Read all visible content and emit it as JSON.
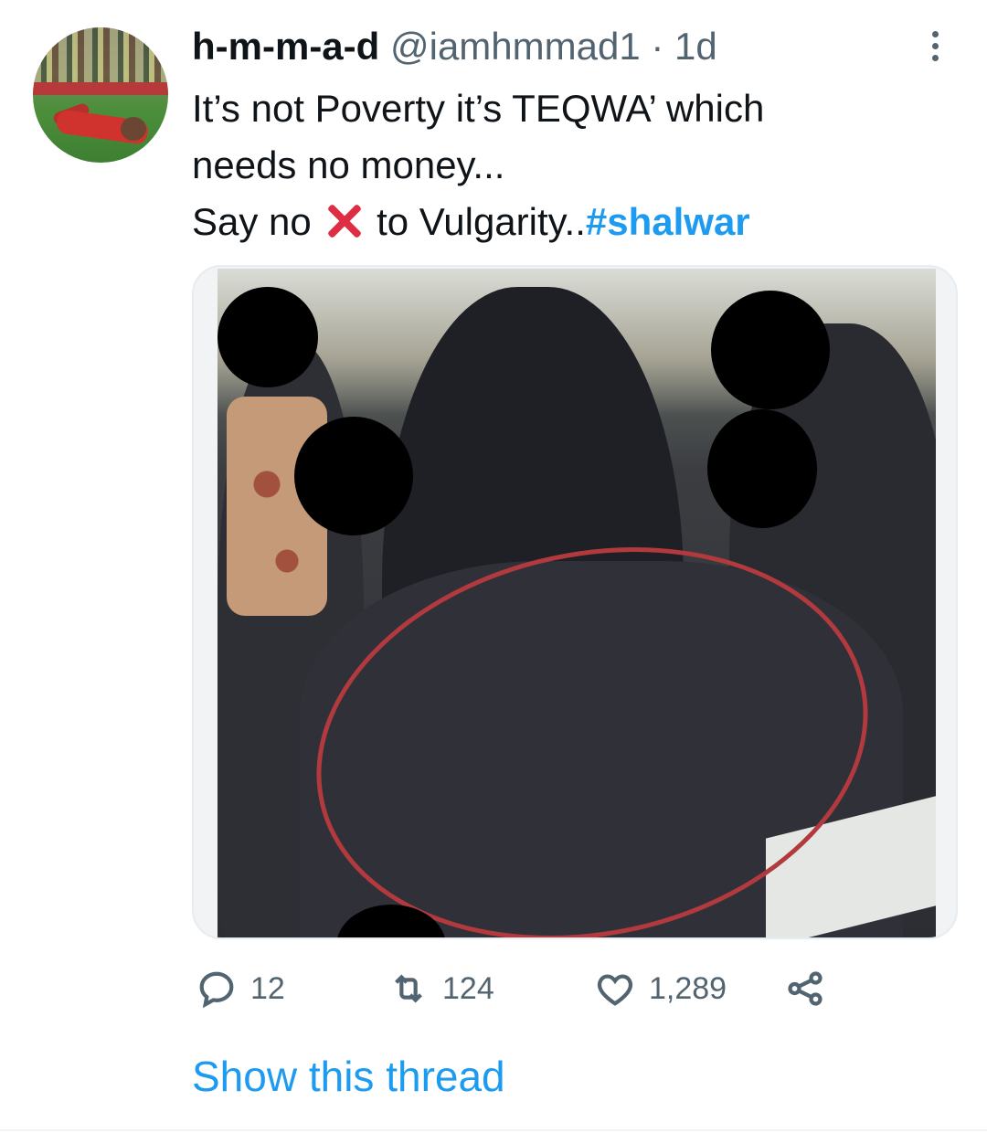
{
  "tweet": {
    "author_name": "h-m-m-a-d",
    "author_handle": "@iamhmmad1",
    "separator": "·",
    "time": "1d",
    "text_line1": "It’s not Poverty it’s TEQWA’ which",
    "text_line2": "needs no money...",
    "text_line3_before": "Say no ",
    "text_line3_after": " to Vulgarity..",
    "hashtag": "#shalwar"
  },
  "icons": {
    "more": "more-horizontal-icon",
    "emoji": "cross-mark-emoji",
    "reply": "reply-icon",
    "retweet": "retweet-icon",
    "like": "like-icon",
    "share": "share-icon"
  },
  "actions": {
    "reply_count": "12",
    "retweet_count": "124",
    "like_count": "1,289"
  },
  "show_thread_label": "Show this thread",
  "colors": {
    "link": "#1d9bf0",
    "text": "#0f1419",
    "secondary": "#536471",
    "emoji_red": "#dd2e44"
  }
}
